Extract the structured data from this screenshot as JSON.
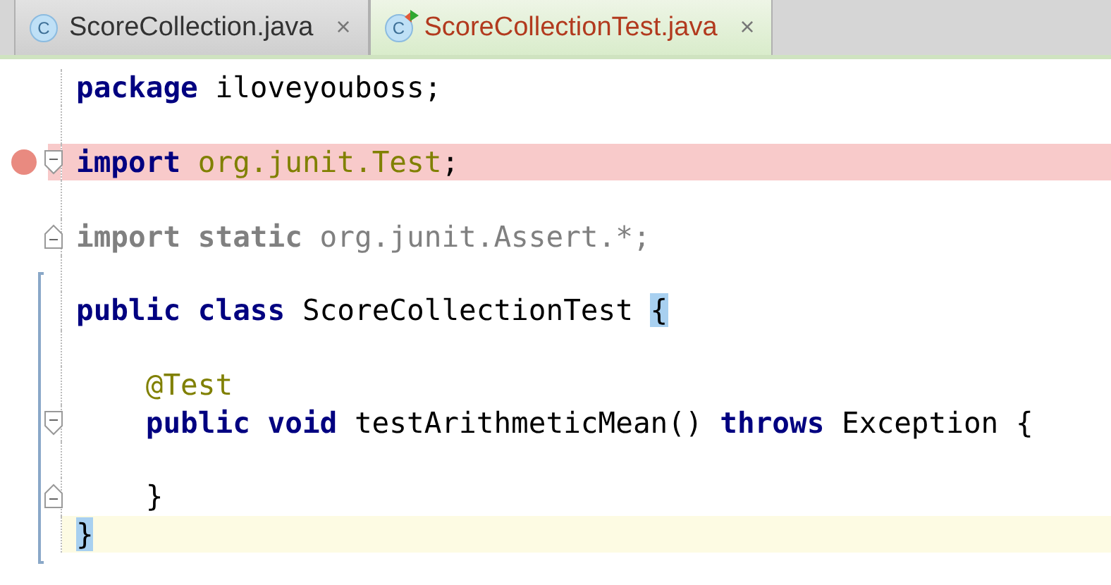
{
  "tabs": [
    {
      "label": "ScoreCollection.java",
      "icon_letter": "C",
      "selected": false,
      "has_errors": false,
      "test_marker": false,
      "close": "×"
    },
    {
      "label": "ScoreCollectionTest.java",
      "icon_letter": "C",
      "selected": true,
      "has_errors": true,
      "test_marker": true,
      "close": "×"
    }
  ],
  "lines": [
    {
      "kind": "code",
      "tokens": [
        {
          "kind": "keyword",
          "text": "package"
        },
        {
          "kind": "plain",
          "text": " iloveyouboss;"
        }
      ]
    },
    {
      "kind": "blank"
    },
    {
      "kind": "code",
      "breakpoint": true,
      "fold_open": true,
      "tokens": [
        {
          "kind": "keyword",
          "text": "import"
        },
        {
          "kind": "reference",
          "text": " org.junit.Test"
        },
        {
          "kind": "plain",
          "text": ";"
        }
      ]
    },
    {
      "kind": "blank"
    },
    {
      "kind": "code",
      "fold_close": true,
      "tokens": [
        {
          "kind": "unused-keyword",
          "text": "import static"
        },
        {
          "kind": "unused",
          "text": " org.junit.Assert.*;"
        }
      ]
    },
    {
      "kind": "blank"
    },
    {
      "kind": "code",
      "in_scope": true,
      "tokens": [
        {
          "kind": "keyword",
          "text": "public class"
        },
        {
          "kind": "plain",
          "text": " ScoreCollectionTest "
        },
        {
          "kind": "brace-match",
          "text": "{"
        }
      ]
    },
    {
      "kind": "blank",
      "in_scope": true
    },
    {
      "kind": "code",
      "in_scope": true,
      "indented": true,
      "tokens": [
        {
          "kind": "annotation",
          "text": "@Test"
        }
      ]
    },
    {
      "kind": "code",
      "in_scope": true,
      "indented": true,
      "fold_open": true,
      "tokens": [
        {
          "kind": "keyword",
          "text": "public void"
        },
        {
          "kind": "plain",
          "text": " testArithmeticMean() "
        },
        {
          "kind": "keyword",
          "text": "throws"
        },
        {
          "kind": "plain",
          "text": " Exception {"
        }
      ]
    },
    {
      "kind": "blank",
      "in_scope": true
    },
    {
      "kind": "code",
      "in_scope": true,
      "indented": true,
      "fold_close": true,
      "tokens": [
        {
          "kind": "plain",
          "text": "}"
        }
      ]
    },
    {
      "kind": "code",
      "in_scope": true,
      "caret_line": true,
      "tokens": [
        {
          "kind": "brace-match",
          "text": "}"
        }
      ]
    }
  ]
}
